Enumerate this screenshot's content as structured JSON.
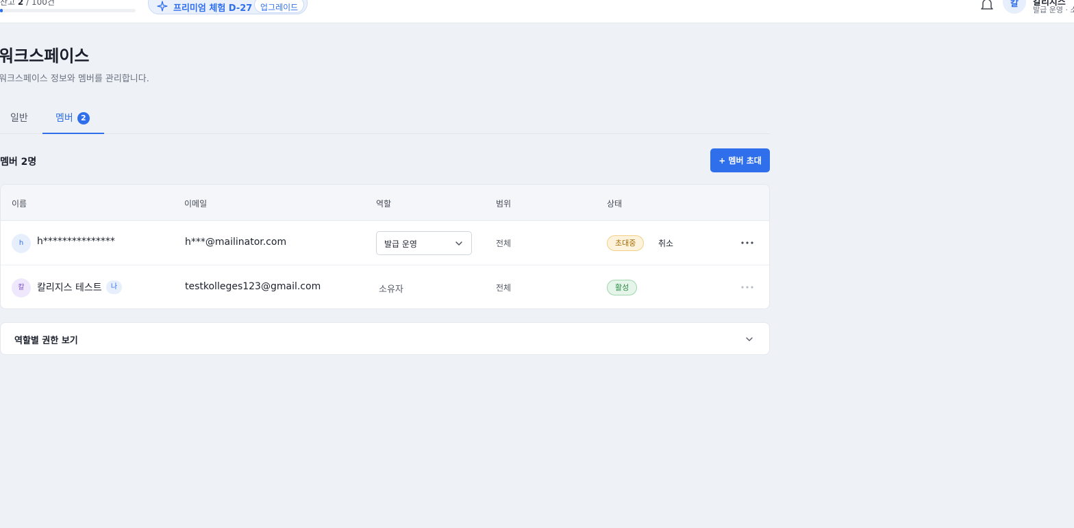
{
  "topbar": {
    "quota_label": "잔고",
    "quota_used": "2",
    "quota_total": "/ 100건",
    "quota_fraction": 0.02,
    "plan_label": "프리미엄 체험 D-27",
    "upgrade_label": "업그레이드",
    "user_initial": "칼",
    "user_name": "칼리지스",
    "user_role": "발급 운영 · 소"
  },
  "page": {
    "title": "워크스페이스",
    "subtitle": "워크스페이스 정보와 멤버를 관리합니다."
  },
  "tabs": [
    {
      "label": "일반",
      "active": false
    },
    {
      "label": "멤버",
      "count": "2",
      "active": true
    }
  ],
  "members": {
    "count_label": "멤버 2명",
    "invite_label": "+ 멤버 초대",
    "columns": [
      "이름",
      "이메일",
      "역할",
      "범위",
      "상태"
    ],
    "rows": [
      {
        "initial": "h",
        "name": "h***************",
        "email": "h***@mailinator.com",
        "role": "발급 운영",
        "scope": "전체",
        "status": "초대중",
        "action": "취소"
      },
      {
        "initial": "칼",
        "name": "칼리지스 테스트",
        "me_badge": "나",
        "email": "testkolleges123@gmail.com",
        "role": "소유자",
        "scope": "전체",
        "status": "활성"
      }
    ]
  },
  "permissions": {
    "title": "역할별 권한 보기"
  },
  "colors": {
    "accent": "#2f6fec",
    "background": "#eef1f6",
    "pending": "#a86a00",
    "active": "#2b8a44"
  },
  "icons": {
    "plan": "sparkle-icon",
    "notifications": "bell-icon",
    "select": "chevron-down-icon",
    "row_menu": "more-horizontal-icon",
    "accordion": "chevron-down-icon"
  }
}
